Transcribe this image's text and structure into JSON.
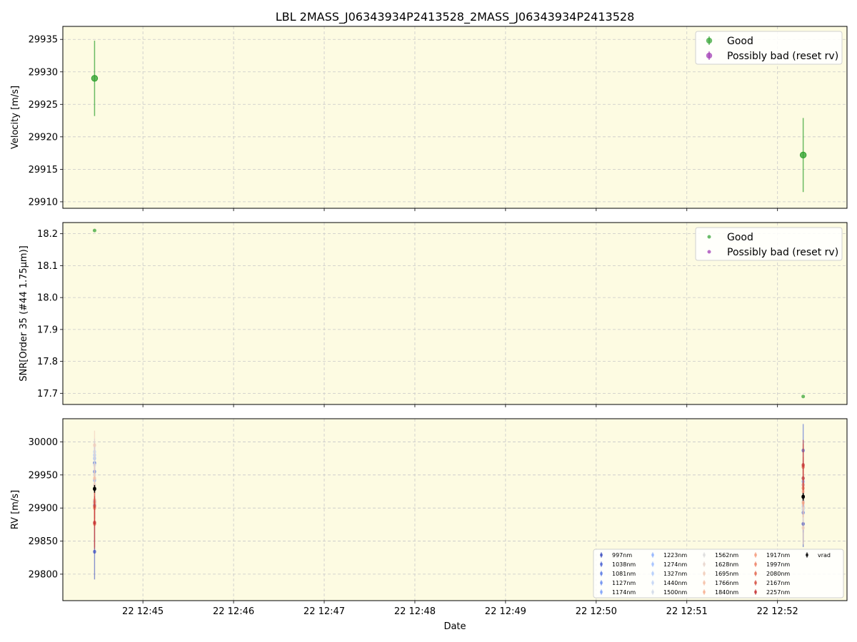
{
  "title": "LBL 2MASS_J06343934P2413528_2MASS_J06343934P2413528",
  "colors": {
    "panel_bg": "#fdfbe2",
    "good": "#2ca02c",
    "bad": "#9b30b0",
    "vrad": "#000000",
    "grid": "#c8c8c8"
  },
  "chart_data": [
    {
      "type": "scatter",
      "panel": "velocity",
      "ylabel": "Velocity [m/s]",
      "ylim": [
        29909,
        29937
      ],
      "yticks": [
        29910,
        29915,
        29920,
        29925,
        29930,
        29935
      ],
      "ytick_labels": [
        "29910",
        "29915",
        "29920",
        "29925",
        "29930",
        "29935"
      ],
      "grid": true,
      "legend_position": "top-right",
      "legend": [
        "Good",
        "Possibly bad (reset rv)"
      ],
      "series": [
        {
          "name": "Good",
          "points": [
            {
              "x": "12:44:28",
              "y": 29929.0,
              "err": 5.8
            },
            {
              "x": "12:52:17",
              "y": 29917.2,
              "err": 5.7
            }
          ]
        },
        {
          "name": "Possibly bad (reset rv)",
          "points": []
        }
      ]
    },
    {
      "type": "scatter",
      "panel": "snr",
      "ylabel": "SNR[Order 35 (#44 1.75μm)]",
      "ylim": [
        17.665,
        18.235
      ],
      "yticks": [
        17.7,
        17.8,
        17.9,
        18.0,
        18.1,
        18.2
      ],
      "ytick_labels": [
        "17.7",
        "17.8",
        "17.9",
        "18.0",
        "18.1",
        "18.2"
      ],
      "grid": true,
      "legend_position": "top-right",
      "legend": [
        "Good",
        "Possibly bad (reset rv)"
      ],
      "series": [
        {
          "name": "Good",
          "points": [
            {
              "x": "12:44:28",
              "y": 18.21
            },
            {
              "x": "12:52:17",
              "y": 17.69
            }
          ]
        },
        {
          "name": "Possibly bad (reset rv)",
          "points": []
        }
      ]
    },
    {
      "type": "scatter",
      "panel": "rv",
      "ylabel": "RV [m/s]",
      "xlabel": "Date",
      "ylim": [
        29760,
        30035
      ],
      "yticks": [
        29800,
        29850,
        29900,
        29950,
        30000
      ],
      "ytick_labels": [
        "29800",
        "29850",
        "29900",
        "29950",
        "30000"
      ],
      "grid": true,
      "legend_position": "bottom-right",
      "legend": [
        "997nm",
        "1038nm",
        "1081nm",
        "1127nm",
        "1174nm",
        "1223nm",
        "1274nm",
        "1327nm",
        "1440nm",
        "1500nm",
        "1562nm",
        "1628nm",
        "1695nm",
        "1766nm",
        "1840nm",
        "1917nm",
        "1997nm",
        "2080nm",
        "2167nm",
        "2257nm",
        "vrad"
      ],
      "series": [
        {
          "name": "997nm",
          "color": "#3b4cc0",
          "values": [
            {
              "x": "12:44:28",
              "y": 29834,
              "err": 42
            },
            {
              "x": "12:52:17",
              "y": 29876,
              "err": 35
            }
          ]
        },
        {
          "name": "1038nm",
          "color": "#4a63d3",
          "values": [
            {
              "x": "12:44:28",
              "y": 29968,
              "err": 30
            },
            {
              "x": "12:52:17",
              "y": 29987,
              "err": 40
            }
          ]
        },
        {
          "name": "1081nm",
          "color": "#5b7ae5",
          "values": [
            {
              "x": "12:44:28",
              "y": 29955,
              "err": 25
            },
            {
              "x": "12:52:17",
              "y": 29893,
              "err": 30
            }
          ]
        },
        {
          "name": "1127nm",
          "color": "#6c8ff1",
          "values": [
            {
              "x": "12:44:28",
              "y": 29910,
              "err": 25
            },
            {
              "x": "12:52:17",
              "y": 29945,
              "err": 28
            }
          ]
        },
        {
          "name": "1174nm",
          "color": "#7ea1fa",
          "values": [
            {
              "x": "12:44:28",
              "y": 29905,
              "err": 22
            },
            {
              "x": "12:52:17",
              "y": 29940,
              "err": 25
            }
          ]
        },
        {
          "name": "1223nm",
          "color": "#8fb1fe",
          "values": [
            {
              "x": "12:44:28",
              "y": 29942,
              "err": 22
            },
            {
              "x": "12:52:17",
              "y": 29935,
              "err": 22
            }
          ]
        },
        {
          "name": "1274nm",
          "color": "#a1c0ff",
          "values": [
            {
              "x": "12:44:28",
              "y": 29975,
              "err": 20
            },
            {
              "x": "12:52:17",
              "y": 29902,
              "err": 22
            }
          ]
        },
        {
          "name": "1327nm",
          "color": "#b2ccfb",
          "values": [
            {
              "x": "12:44:28",
              "y": 29980,
              "err": 20
            },
            {
              "x": "12:52:17",
              "y": 29898,
              "err": 20
            }
          ]
        },
        {
          "name": "1440nm",
          "color": "#c3d5f4",
          "values": [
            {
              "x": "12:44:28",
              "y": 29985,
              "err": 20
            },
            {
              "x": "12:52:17",
              "y": 29910,
              "err": 20
            }
          ]
        },
        {
          "name": "1500nm",
          "color": "#d2dbe8",
          "values": [
            {
              "x": "12:44:28",
              "y": 29965,
              "err": 22
            },
            {
              "x": "12:52:17",
              "y": 29905,
              "err": 22
            }
          ]
        },
        {
          "name": "1562nm",
          "color": "#dddcdc",
          "values": [
            {
              "x": "12:44:28",
              "y": 29950,
              "err": 22
            },
            {
              "x": "12:52:17",
              "y": 29900,
              "err": 22
            }
          ]
        },
        {
          "name": "1628nm",
          "color": "#e8d6cc",
          "values": [
            {
              "x": "12:44:28",
              "y": 29935,
              "err": 22
            },
            {
              "x": "12:52:17",
              "y": 29918,
              "err": 22
            }
          ]
        },
        {
          "name": "1695nm",
          "color": "#f1cdba",
          "values": [
            {
              "x": "12:44:28",
              "y": 29995,
              "err": 22
            },
            {
              "x": "12:52:17",
              "y": 29870,
              "err": 25
            }
          ]
        },
        {
          "name": "1766nm",
          "color": "#f6bfa6",
          "values": [
            {
              "x": "12:44:28",
              "y": 29945,
              "err": 22
            },
            {
              "x": "12:52:17",
              "y": 29925,
              "err": 22
            }
          ]
        },
        {
          "name": "1840nm",
          "color": "#f7af91",
          "values": [
            {
              "x": "12:44:28",
              "y": 29912,
              "err": 22
            },
            {
              "x": "12:52:17",
              "y": 29908,
              "err": 22
            }
          ]
        },
        {
          "name": "1917nm",
          "color": "#f59c7d",
          "values": [
            {
              "x": "12:44:28",
              "y": 29908,
              "err": 25
            },
            {
              "x": "12:52:17",
              "y": 29935,
              "err": 25
            }
          ]
        },
        {
          "name": "1997nm",
          "color": "#ee8468",
          "values": [
            {
              "x": "12:44:28",
              "y": 29900,
              "err": 28
            },
            {
              "x": "12:52:17",
              "y": 29930,
              "err": 28
            }
          ]
        },
        {
          "name": "2080nm",
          "color": "#e36c55",
          "values": [
            {
              "x": "12:44:28",
              "y": 29876,
              "err": 35
            },
            {
              "x": "12:52:17",
              "y": 29962,
              "err": 35
            }
          ]
        },
        {
          "name": "2167nm",
          "color": "#d65244",
          "values": [
            {
              "x": "12:44:28",
              "y": 29903,
              "err": 30
            },
            {
              "x": "12:52:17",
              "y": 29945,
              "err": 32
            }
          ]
        },
        {
          "name": "2257nm",
          "color": "#c43032",
          "values": [
            {
              "x": "12:44:28",
              "y": 29878,
              "err": 40
            },
            {
              "x": "12:52:17",
              "y": 29965,
              "err": 38
            }
          ]
        },
        {
          "name": "vrad",
          "color": "#000000",
          "values": [
            {
              "x": "12:44:28",
              "y": 29929,
              "err": 5.8
            },
            {
              "x": "12:52:17",
              "y": 29917,
              "err": 5.7
            }
          ]
        }
      ]
    }
  ],
  "x_axis": {
    "range": [
      "12:44:07",
      "12:52:46"
    ],
    "ticks": [
      "12:45:00",
      "12:46:00",
      "12:47:00",
      "12:48:00",
      "12:49:00",
      "12:50:00",
      "12:51:00",
      "12:52:00"
    ],
    "tick_labels": [
      "22 12:45",
      "22 12:46",
      "22 12:47",
      "22 12:48",
      "22 12:49",
      "22 12:50",
      "22 12:51",
      "22 12:52"
    ],
    "label": "Date"
  }
}
